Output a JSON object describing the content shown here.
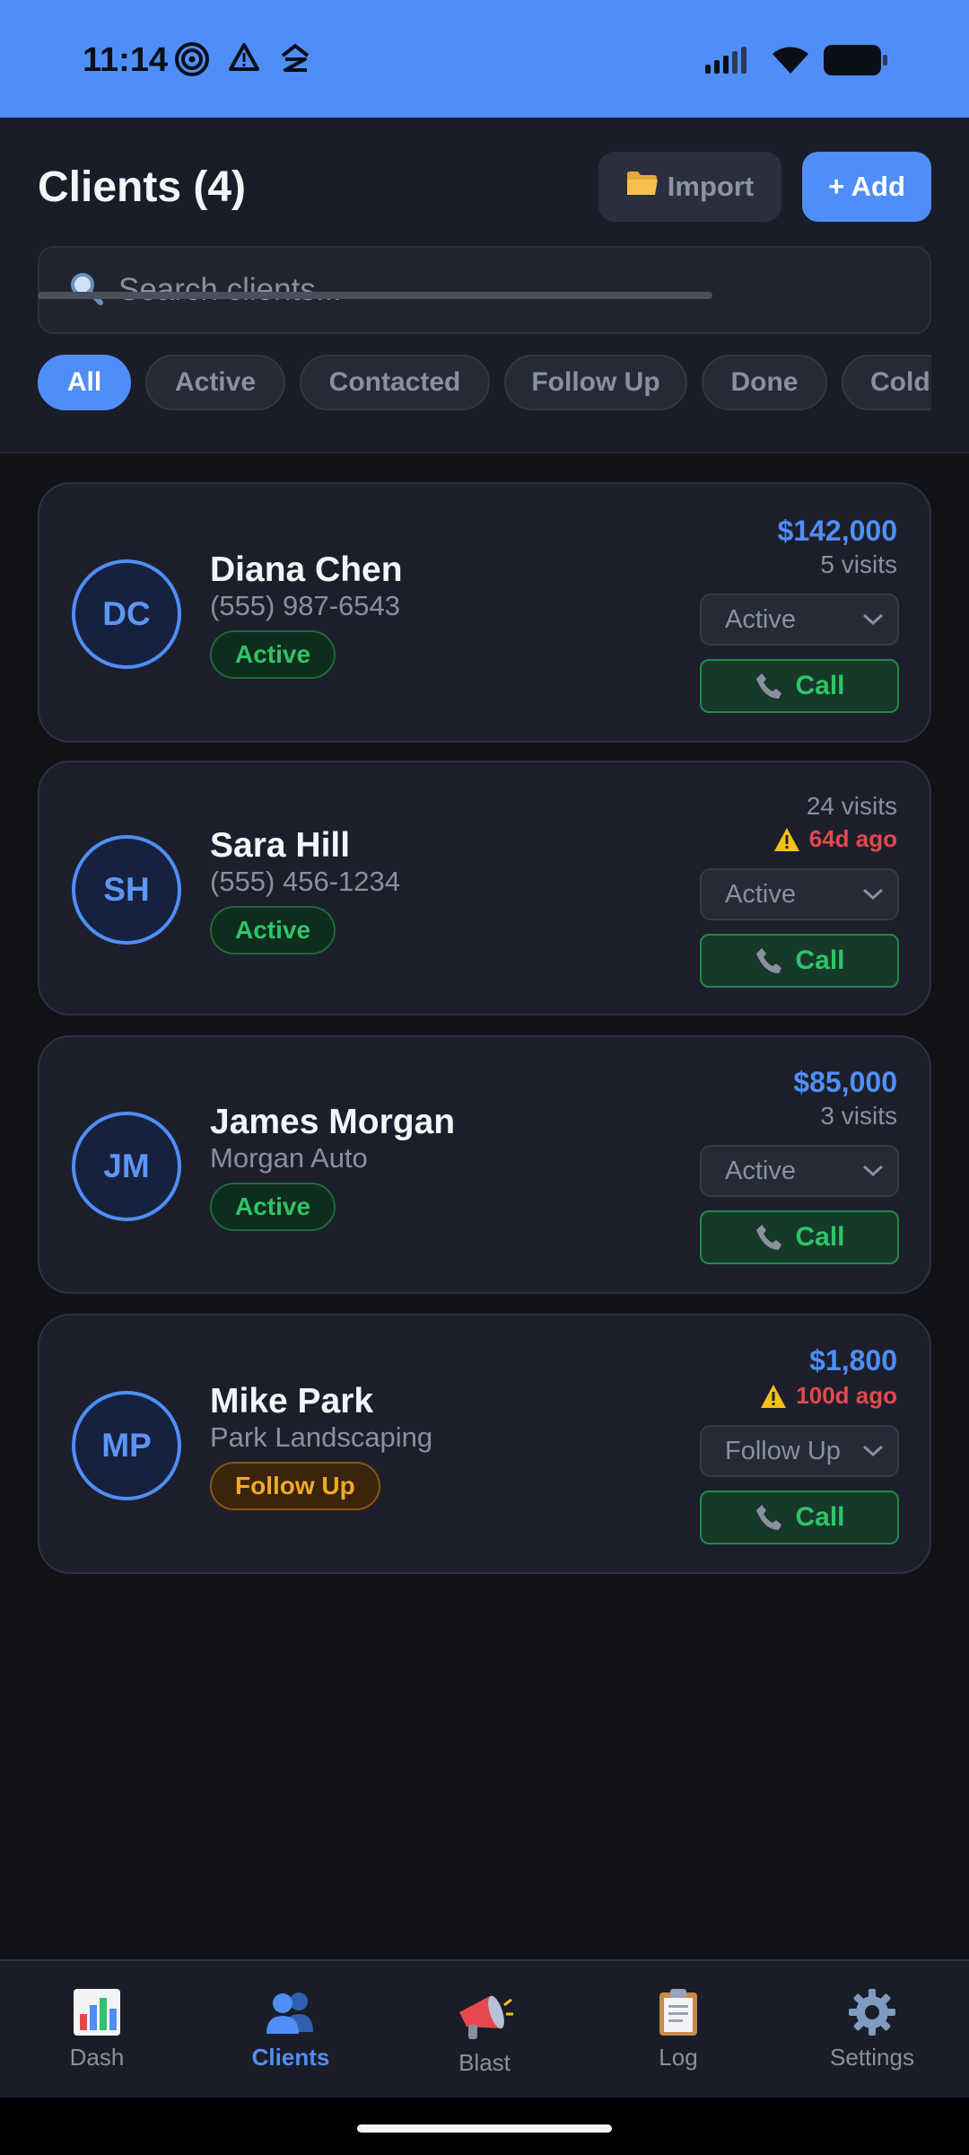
{
  "status_bar": {
    "time": "11:14"
  },
  "header": {
    "title": "Clients (4)",
    "import_label": "Import",
    "add_label": "+ Add",
    "search_placeholder": "Search clients..."
  },
  "filters": [
    "All",
    "Active",
    "Contacted",
    "Follow Up",
    "Done",
    "Cold"
  ],
  "selected_filter": "All",
  "clients": [
    {
      "initials": "DC",
      "name": "Diana Chen",
      "subtitle": "(555) 987-6543",
      "status": "Active",
      "amount": "$142,000",
      "visits": "5 visits",
      "warning": "",
      "select_value": "Active",
      "call_label": "Call"
    },
    {
      "initials": "SH",
      "name": "Sara Hill",
      "subtitle": "(555) 456-1234",
      "status": "Active",
      "amount": "",
      "visits": "24 visits",
      "warning": "64d ago",
      "select_value": "Active",
      "call_label": "Call"
    },
    {
      "initials": "JM",
      "name": "James Morgan",
      "subtitle": "Morgan Auto",
      "status": "Active",
      "amount": "$85,000",
      "visits": "3 visits",
      "warning": "",
      "select_value": "Active",
      "call_label": "Call"
    },
    {
      "initials": "MP",
      "name": "Mike Park",
      "subtitle": "Park Landscaping",
      "status": "Follow Up",
      "amount": "$1,800",
      "visits": "",
      "warning": "100d ago",
      "select_value": "Follow Up",
      "call_label": "Call"
    }
  ],
  "nav": [
    {
      "label": "Dash",
      "icon": "bar-chart-icon"
    },
    {
      "label": "Clients",
      "icon": "people-icon",
      "active": true
    },
    {
      "label": "Blast",
      "icon": "megaphone-icon"
    },
    {
      "label": "Log",
      "icon": "clipboard-icon"
    },
    {
      "label": "Settings",
      "icon": "gear-icon"
    }
  ],
  "colors": {
    "accent": "#4f8ef7",
    "active_green": "#2fc468",
    "follow_up_orange": "#f4a72a",
    "warning_red": "#e5484d",
    "background": "#111217"
  }
}
